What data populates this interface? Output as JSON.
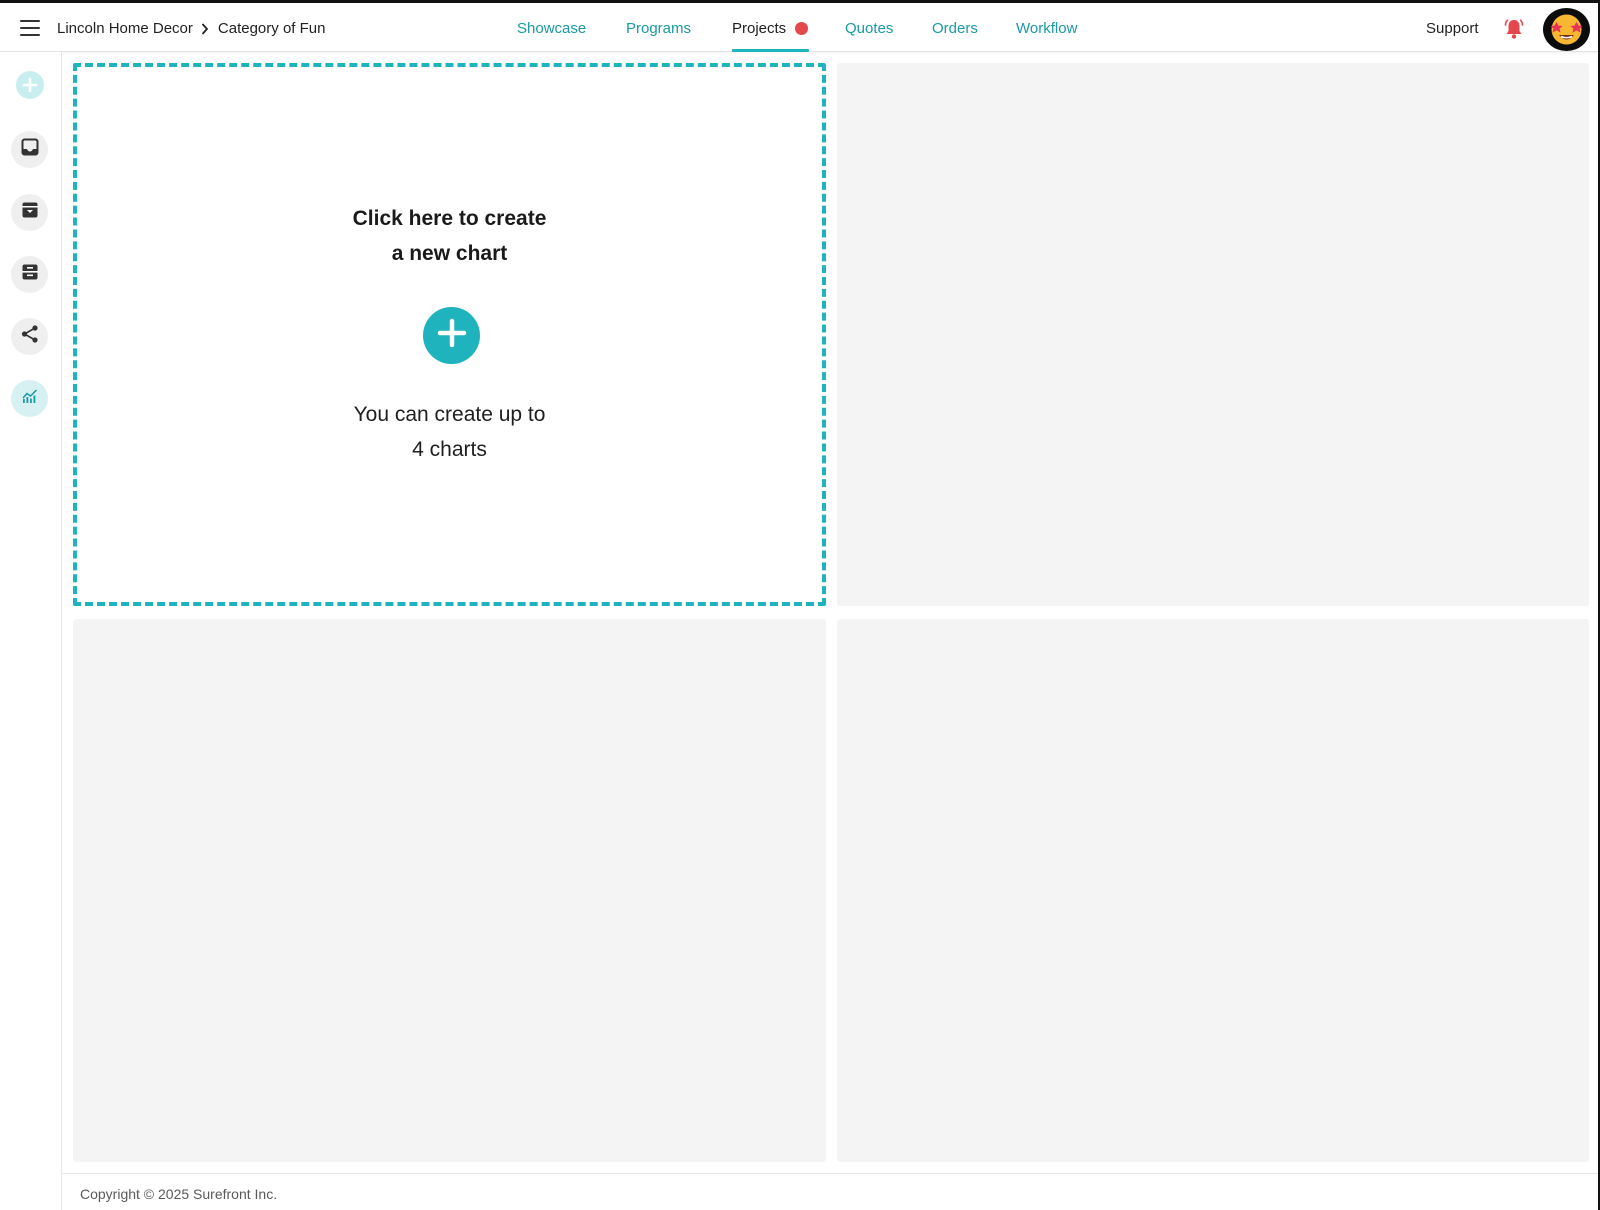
{
  "header": {
    "breadcrumb": {
      "company": "Lincoln Home Decor",
      "category": "Category of Fun"
    },
    "nav": [
      {
        "label": "Showcase",
        "active": false
      },
      {
        "label": "Programs",
        "active": false
      },
      {
        "label": "Projects",
        "active": true,
        "badge": "notification-dot"
      },
      {
        "label": "Quotes",
        "active": false
      },
      {
        "label": "Orders",
        "active": false
      },
      {
        "label": "Workflow",
        "active": false
      }
    ],
    "support_label": "Support",
    "bell_icon": "bell-icon",
    "avatar_icon": "star-struck-emoji-avatar"
  },
  "sidebar": {
    "items": [
      {
        "name": "add-icon",
        "active": false
      },
      {
        "name": "inbox-icon",
        "active": false
      },
      {
        "name": "archive-icon",
        "active": false
      },
      {
        "name": "tray-icon",
        "active": false
      },
      {
        "name": "share-icon",
        "active": false
      },
      {
        "name": "analytics-icon",
        "active": true
      }
    ]
  },
  "main": {
    "create_chart": {
      "title_line1": "Click here to create",
      "title_line2": "a new chart",
      "note_line1": "You can create up to",
      "note_line2": "4 charts"
    }
  },
  "footer": {
    "copyright": "Copyright © 2025 Surefront Inc."
  },
  "colors": {
    "accent": "#1eb3bd",
    "nav_link": "#1a9aa3",
    "alert": "#e4474c",
    "panel_bg": "#f4f4f4"
  }
}
